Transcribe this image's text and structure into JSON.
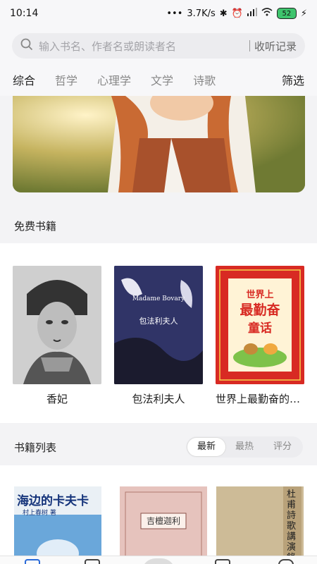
{
  "status": {
    "time": "10:14",
    "speed": "3.7K/s",
    "battery": "52"
  },
  "search": {
    "placeholder": "输入书名、作者名或朗读者名",
    "history_label": "收听记录"
  },
  "tabs": [
    "综合",
    "哲学",
    "心理学",
    "文学",
    "诗歌"
  ],
  "filter_label": "筛选",
  "free_section": {
    "title": "免费书籍",
    "books": [
      {
        "title": "香妃"
      },
      {
        "title": "包法利夫人",
        "cover_text": "包法利夫人",
        "cover_en": "Madame Bovary"
      },
      {
        "title": "世界上最勤奋的童话",
        "cover_text_1": "世界上",
        "cover_text_2": "最勤奋",
        "cover_text_3": "的",
        "cover_text_4": "童话"
      }
    ]
  },
  "list_section": {
    "title": "书籍列表",
    "sort_options": [
      "最新",
      "最热",
      "评分"
    ],
    "active_sort": "最新",
    "books": [
      {
        "cover_text": "海边的卡夫卡",
        "author": "村上春树 著"
      },
      {
        "cover_text": "吉檀迦利"
      },
      {
        "cover_text": "杜甫詩歌講演錄"
      }
    ]
  },
  "colors": {
    "background": "#f3f3f5",
    "active_tab": "#222222",
    "inactive_tab": "#888888"
  }
}
